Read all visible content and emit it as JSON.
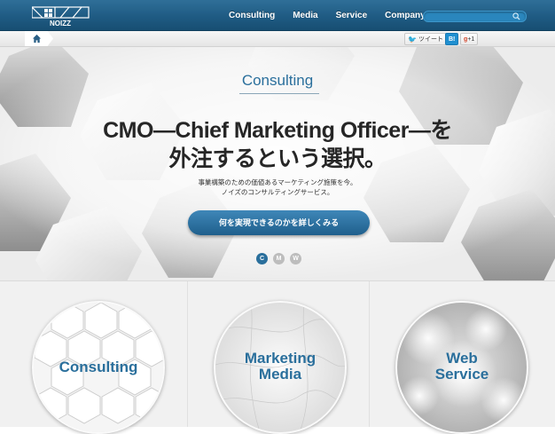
{
  "header": {
    "logo_text": "NOIZZ",
    "nav": [
      {
        "label": "Consulting"
      },
      {
        "label": "Media"
      },
      {
        "label": "Service"
      },
      {
        "label": "Company"
      }
    ],
    "search_placeholder": ""
  },
  "breadcrumb": {
    "home_icon": "home-icon"
  },
  "share": {
    "tweet_label": "ツイート",
    "hatena_label": "B!",
    "gplus_label": "+1"
  },
  "hero": {
    "label": "Consulting",
    "headline_line1": "CMO―Chief Marketing Officer―を",
    "headline_line2": "外注するという選択。",
    "sub_line1": "事業構築のための価値あるマーケティング施策を今。",
    "sub_line2": "ノイズのコンサルティングサービス。",
    "cta_label": "何を実現できるのかを詳しくみる",
    "slides": [
      {
        "letter": "C",
        "active": true
      },
      {
        "letter": "M",
        "active": false
      },
      {
        "letter": "W",
        "active": false
      }
    ]
  },
  "cards": [
    {
      "line1": "Consulting",
      "line2": ""
    },
    {
      "line1": "Marketing",
      "line2": "Media"
    },
    {
      "line1": "Web",
      "line2": "Service"
    }
  ],
  "colors": {
    "brand_blue": "#2a6f9c",
    "nav_bar": "#1f5b83",
    "headline": "#262626"
  }
}
